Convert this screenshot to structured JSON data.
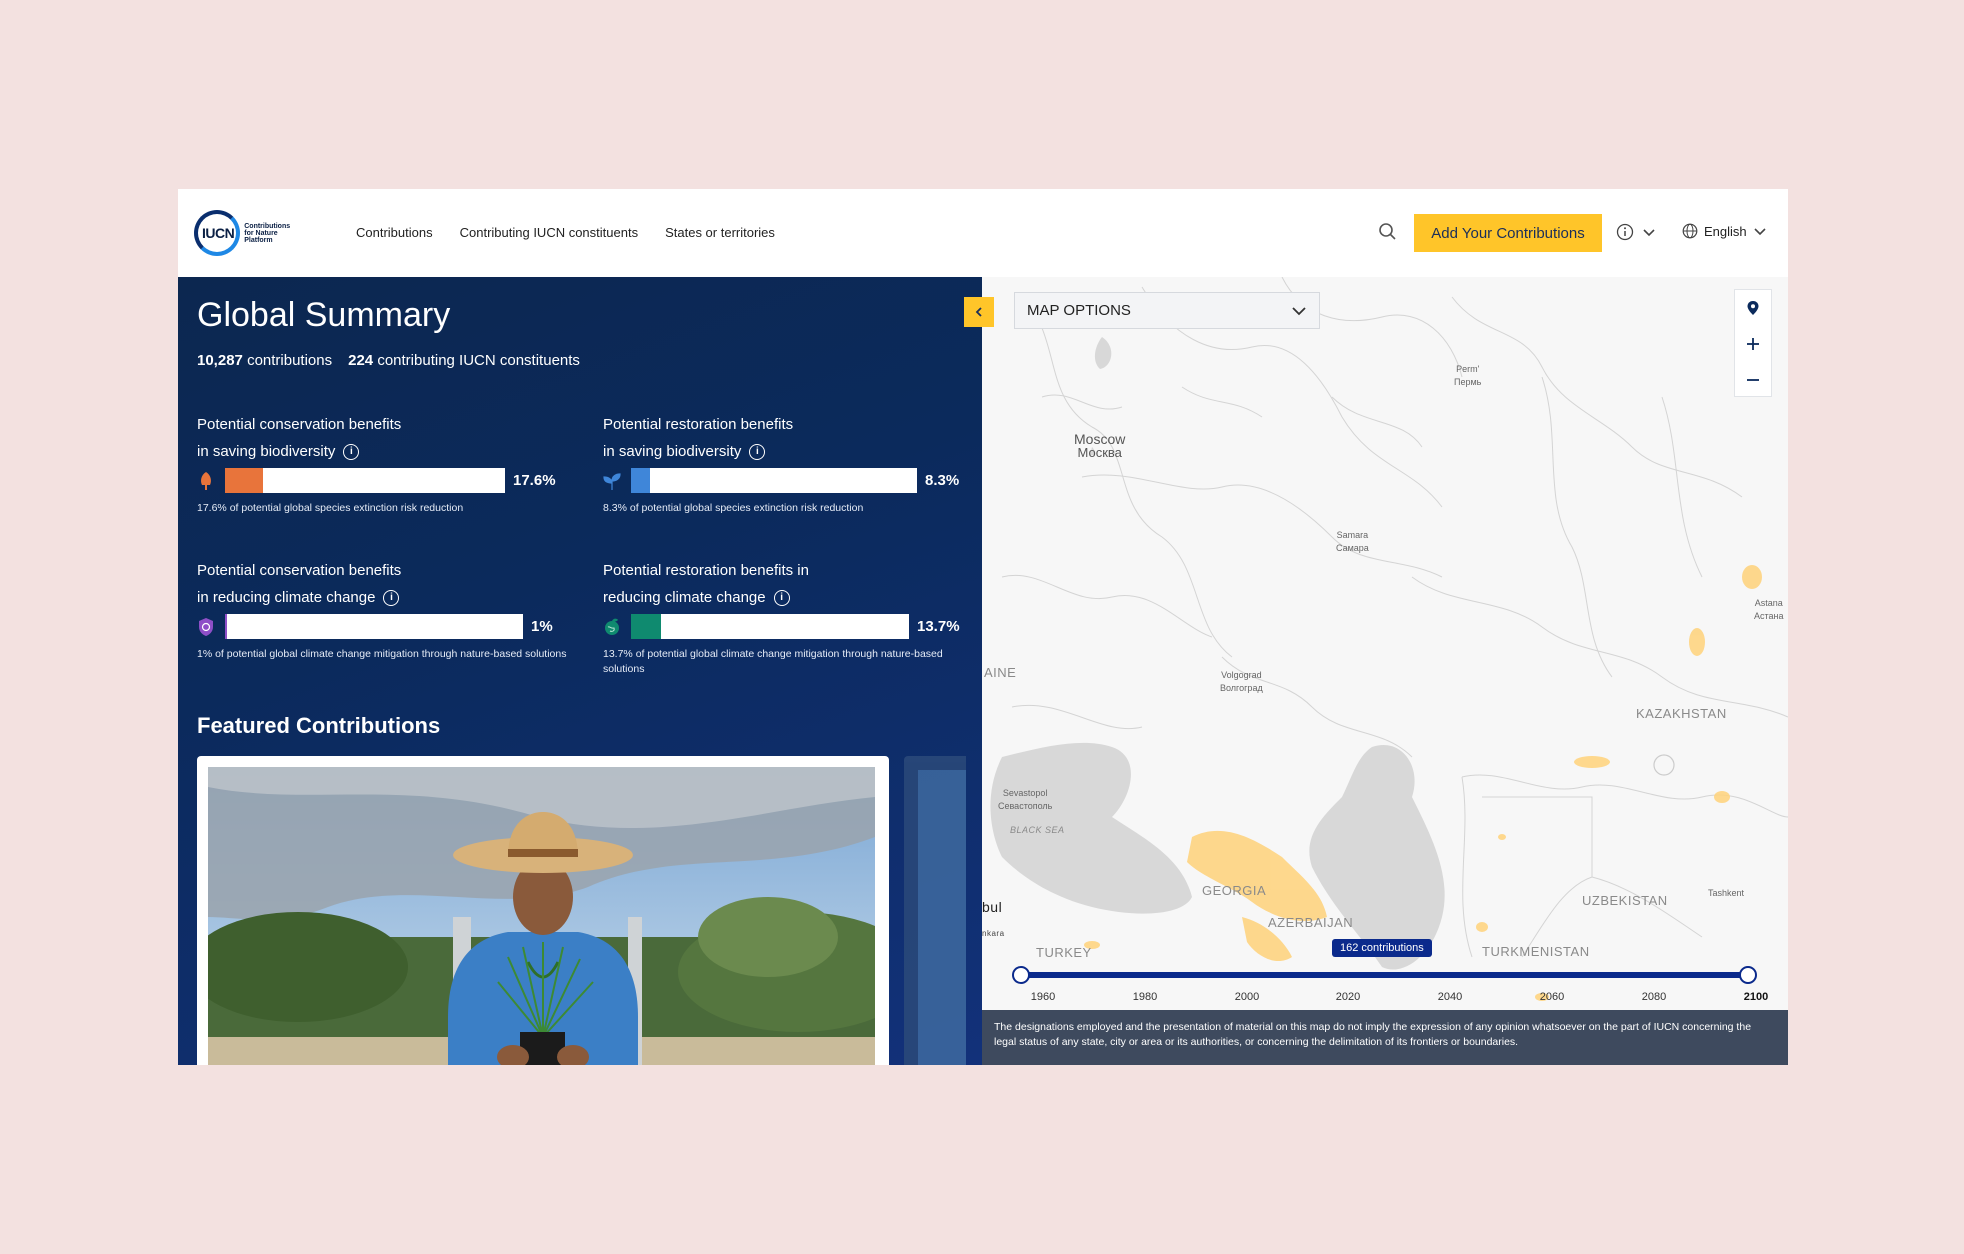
{
  "header": {
    "logo_word": "IUCN",
    "logo_sub": "Contributions for Nature Platform",
    "nav": [
      "Contributions",
      "Contributing IUCN constituents",
      "States or territories"
    ],
    "add_button": "Add Your Contributions",
    "language": "English"
  },
  "summary": {
    "title": "Global Summary",
    "contributions_count": "10,287",
    "contributions_label": "contributions",
    "constituents_count": "224",
    "constituents_label": "contributing IUCN constituents"
  },
  "metrics": [
    {
      "line1": "Potential conservation benefits",
      "line2": "in saving biodiversity",
      "value": "17.6%",
      "fraction": 0.176,
      "color": "#e8743b",
      "desc": "17.6% of potential global species extinction risk reduction"
    },
    {
      "line1": "Potential restoration benefits",
      "line2": "in saving biodiversity",
      "value": "8.3%",
      "fraction": 0.083,
      "color": "#3f86d9",
      "desc": "8.3% of potential global species extinction risk reduction"
    },
    {
      "line1": "Potential conservation benefits",
      "line2": "in reducing climate change",
      "value": "1%",
      "fraction": 0.01,
      "color": "#8e4fc7",
      "desc": "1% of potential global climate change mitigation through nature-based solutions"
    },
    {
      "line1": "Potential restoration benefits in",
      "line2": "reducing climate change",
      "value": "13.7%",
      "fraction": 0.137,
      "color": "#0f8a6f",
      "desc": "13.7% of potential global climate change mitigation through nature-based solutions"
    }
  ],
  "featured": {
    "title": "Featured Contributions"
  },
  "map": {
    "options_label": "MAP OPTIONS",
    "cities": [
      {
        "en": "Moscow",
        "local": "Москва"
      },
      {
        "en": "Perm'",
        "local": "Пермь"
      },
      {
        "en": "Samara",
        "local": "Самара"
      },
      {
        "en": "Volgograd",
        "local": "Волгоград"
      },
      {
        "en": "Sevastopol",
        "local": "Севастополь"
      },
      {
        "en": "Astana",
        "local": "Астана"
      },
      {
        "en": "Tashkent",
        "local": ""
      }
    ],
    "countries": [
      "KAZAKHSTAN",
      "UZBEKISTAN",
      "TURKMENISTAN",
      "GEORGIA",
      "AZERBAIJAN",
      "TURKEY",
      "AINE",
      "BLACK SEA",
      "bul",
      "nkara"
    ],
    "timeline": {
      "badge": "162 contributions",
      "years": [
        "1960",
        "1980",
        "2000",
        "2020",
        "2040",
        "2060",
        "2080",
        "2100"
      ]
    },
    "disclaimer": "The designations employed and the presentation of material on this map do not imply the expression of any opinion whatsoever on the part of IUCN concerning the legal status of any state, city or area or its authorities, or concerning the delimitation of its frontiers or boundaries."
  }
}
